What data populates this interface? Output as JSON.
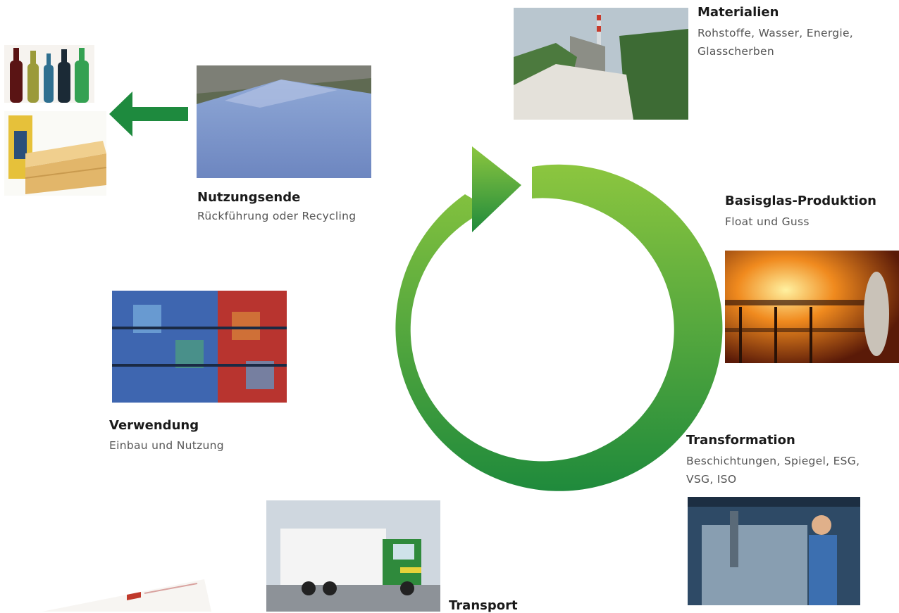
{
  "colors": {
    "arrow_light": "#8cc63f",
    "arrow_dark": "#1f8a3c",
    "side_arrow": "#1e8a3e"
  },
  "stages": {
    "materialien": {
      "title": "Materialien",
      "desc_1": "Rohstoffe, Wasser, Energie,",
      "desc_2": "Glasscherben",
      "image": "quarry-photo"
    },
    "basisglas": {
      "title": "Basisglas-Produktion",
      "desc": "Float und Guss",
      "image": "furnace-photo"
    },
    "transformation": {
      "title": "Transformation",
      "desc_1": "Beschichtungen, Spiegel, ESG,",
      "desc_2": "VSG, ISO",
      "image": "glass-handling-photo"
    },
    "transport": {
      "title": "Transport",
      "image": "truck-photo"
    },
    "verwendung": {
      "title": "Verwendung",
      "desc": "Einbau und Nutzung",
      "image": "glass-facade-photo"
    },
    "nutzungsende": {
      "title": "Nutzungsende",
      "desc": "Rückführung oder Recycling",
      "image": "cullet-pile-photo"
    }
  },
  "recycling_products": [
    "bottles-photo",
    "insulation-wool-photo"
  ]
}
